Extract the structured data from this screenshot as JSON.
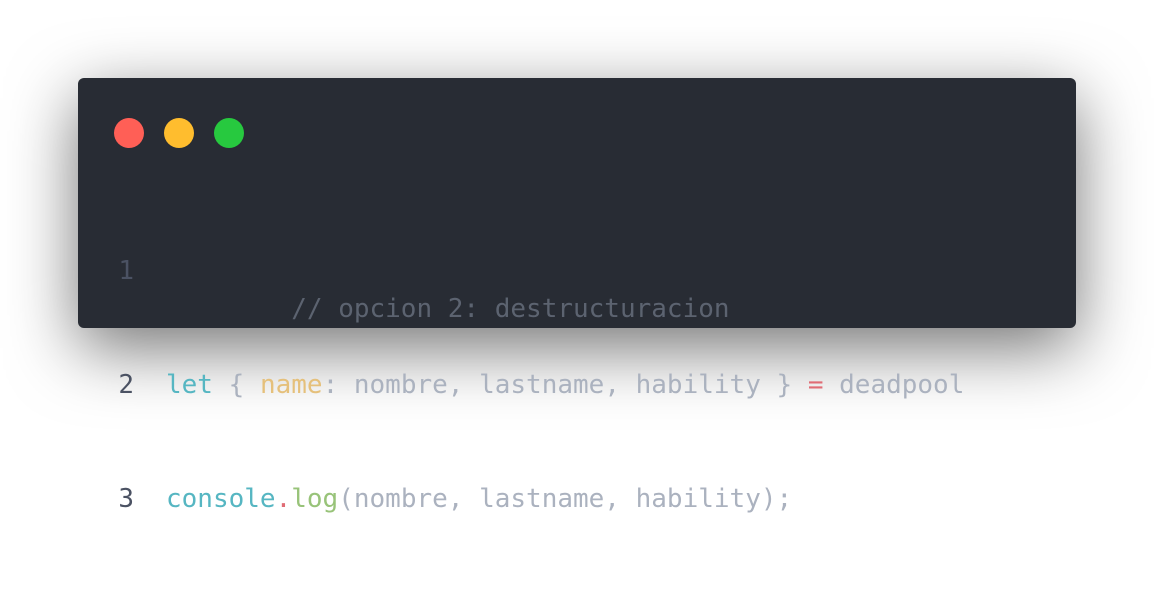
{
  "window": {
    "dots": [
      {
        "name": "close",
        "color": "#ff5f56"
      },
      {
        "name": "minimize",
        "color": "#ffbd2e"
      },
      {
        "name": "maximize",
        "color": "#27c93f"
      }
    ]
  },
  "code": {
    "lines": [
      {
        "number": "1",
        "tokens": [
          {
            "text": "// opcion 2: destructuracion",
            "kind": "comment"
          }
        ]
      },
      {
        "number": "2",
        "tokens": [
          {
            "text": "let",
            "kind": "keyword"
          },
          {
            "text": " { ",
            "kind": "plain"
          },
          {
            "text": "name",
            "kind": "prop"
          },
          {
            "text": ": nombre, lastname, hability } ",
            "kind": "plain"
          },
          {
            "text": "=",
            "kind": "op"
          },
          {
            "text": " deadpool",
            "kind": "plain"
          }
        ]
      },
      {
        "number": "3",
        "tokens": [
          {
            "text": "console",
            "kind": "obj"
          },
          {
            "text": ".",
            "kind": "op"
          },
          {
            "text": "log",
            "kind": "func"
          },
          {
            "text": "(nombre, lastname, hability);",
            "kind": "plain"
          }
        ]
      }
    ]
  }
}
